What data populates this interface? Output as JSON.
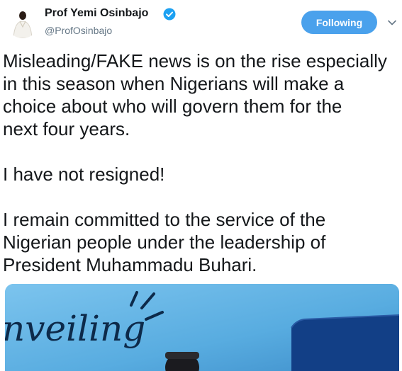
{
  "user": {
    "display_name": "Prof Yemi Osinbajo",
    "handle": "@ProfOsinbajo",
    "verified_icon": "verified-badge-icon"
  },
  "actions": {
    "follow_label": "Following",
    "more_icon": "chevron-down-icon"
  },
  "tweet": {
    "lines": [
      "Misleading/FAKE news is on the rise especially",
      "in this season when Nigerians will make a",
      "choice about who will govern them for the",
      "next four years.",
      "",
      "I have not resigned!",
      "",
      "I remain committed to the service of the",
      "Nigerian people under the leadership of",
      "President Muhammadu Buhari."
    ]
  },
  "media": {
    "sign_text": "nveiling"
  },
  "colors": {
    "accent": "#4aa1ec",
    "handle": "#657786",
    "text": "#14171a",
    "media_background": "#5fb6e8"
  }
}
